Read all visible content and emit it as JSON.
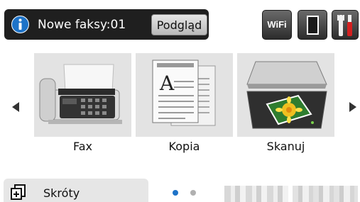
{
  "notification": {
    "text": "Nowe faksy:01",
    "preview_label": "Podgląd",
    "icon": "info-icon"
  },
  "status_icons": {
    "wifi_label": "WiFi",
    "toner_icon": "toner-icon",
    "settings_icon": "settings-tools-icon"
  },
  "functions": [
    {
      "label": "Fax",
      "icon": "fax-machine-icon"
    },
    {
      "label": "Kopia",
      "icon": "copy-document-icon"
    },
    {
      "label": "Skanuj",
      "icon": "scanner-icon"
    }
  ],
  "navigation": {
    "prev_icon": "arrow-left-icon",
    "next_icon": "arrow-right-icon"
  },
  "bottom": {
    "shortcuts_label": "Skróty",
    "shortcuts_icon": "shortcuts-plus-icon",
    "page_count": 2,
    "active_page": 1
  },
  "colors": {
    "notification_bg": "#1f1f1f",
    "tile_bg": "#e3e3e3",
    "active_dot": "#1e73c8",
    "inactive_dot": "#b0b0b0",
    "info_blue": "#1e73c8"
  }
}
